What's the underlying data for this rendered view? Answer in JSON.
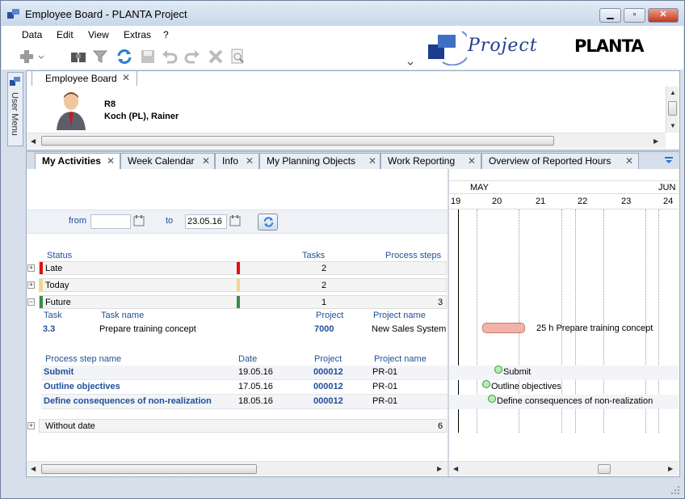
{
  "window": {
    "title": "Employee Board - PLANTA Project",
    "min": "▁",
    "max": "▫",
    "close": "✕"
  },
  "menu": [
    "Data",
    "Edit",
    "View",
    "Extras",
    "?"
  ],
  "brand": {
    "product": "Project",
    "company": "PLANTA"
  },
  "side": {
    "user_menu": "User Menu"
  },
  "top_tab": {
    "label": "Employee Board"
  },
  "employee": {
    "id": "R8",
    "name": "Koch (PL), Rainer"
  },
  "tabs": [
    "My Activities",
    "Week Calendar",
    "Info",
    "My Planning Objects",
    "Work Reporting",
    "Overview of Reported Hours"
  ],
  "filter": {
    "from_label": "from",
    "from_value": "",
    "to_label": "to",
    "to_value": "23.05.16"
  },
  "status_header": {
    "status": "Status",
    "tasks": "Tasks",
    "process_steps": "Process steps"
  },
  "groups": [
    {
      "label": "Late",
      "tasks": "2",
      "steps": "",
      "color": "#e01010",
      "expander": "+"
    },
    {
      "label": "Today",
      "tasks": "2",
      "steps": "",
      "color": "#f5d58a",
      "expander": "+"
    },
    {
      "label": "Future",
      "tasks": "1",
      "steps": "3",
      "color": "#3a8a4a",
      "expander": "−"
    }
  ],
  "task_header": {
    "task": "Task",
    "name": "Task name",
    "project": "Project",
    "project_name": "Project name"
  },
  "task_row": {
    "task": "3.3",
    "name": "Prepare training concept",
    "project": "7000",
    "project_name": "New Sales System"
  },
  "step_header": {
    "name": "Process step name",
    "date": "Date",
    "project": "Project",
    "project_name": "Project name"
  },
  "steps": [
    {
      "name": "Submit",
      "date": "19.05.16",
      "project": "000012",
      "project_name": "PR-01"
    },
    {
      "name": "Outline objectives",
      "date": "17.05.16",
      "project": "000012",
      "project_name": "PR-01"
    },
    {
      "name": "Define consequences of non-realization",
      "date": "18.05.16",
      "project": "000012",
      "project_name": "PR-01"
    }
  ],
  "without_date": {
    "label": "Without date",
    "count": "6"
  },
  "gantt": {
    "months": [
      "MAY",
      "JUN"
    ],
    "days": [
      "19",
      "20",
      "21",
      "22",
      "23",
      "24"
    ],
    "task_label": "25 h  Prepare training concept",
    "milestones": [
      "Submit",
      "Outline objectives",
      "Define consequences of non-realization"
    ]
  }
}
